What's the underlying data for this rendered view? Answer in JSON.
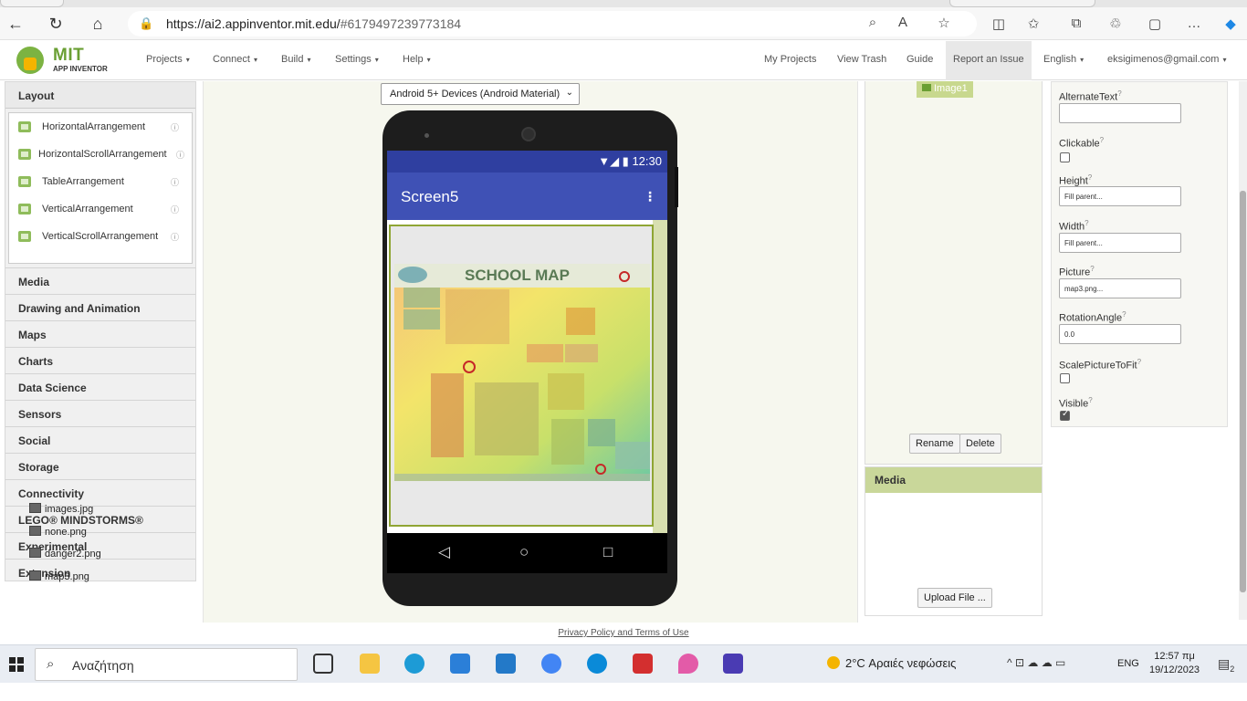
{
  "browser": {
    "url_main": "https://ai2.appinventor.mit.edu/",
    "url_rest": "#6179497239773184"
  },
  "header": {
    "logo_top": "MIT",
    "logo_bottom": "APP INVENTOR",
    "menus": [
      "Projects",
      "Connect",
      "Build",
      "Settings",
      "Help"
    ],
    "right_links": [
      "My Projects",
      "View Trash",
      "Guide",
      "Report an Issue",
      "English",
      "eksigimenos@gmail.com"
    ]
  },
  "palette": {
    "layout_title": "Layout",
    "layout_items": [
      "HorizontalArrangement",
      "HorizontalScrollArrangement",
      "TableArrangement",
      "VerticalArrangement",
      "VerticalScrollArrangement"
    ],
    "categories": [
      "Media",
      "Drawing and Animation",
      "Maps",
      "Charts",
      "Data Science",
      "Sensors",
      "Social",
      "Storage",
      "Connectivity",
      "LEGO® MINDSTORMS®",
      "Experimental",
      "Extension"
    ]
  },
  "viewer": {
    "device_select": "Android 5+ Devices (Android Material)",
    "status_time": "12:30",
    "screen_title": "Screen5",
    "map_title": "SCHOOL MAP"
  },
  "components": {
    "selected": "Image1",
    "rename_label": "Rename",
    "delete_label": "Delete"
  },
  "media": {
    "title": "Media",
    "files": [
      "images.jpg",
      "none.png",
      "danger2.png",
      "map3.png"
    ],
    "upload_label": "Upload File ..."
  },
  "properties": {
    "alternate_text": "AlternateText",
    "clickable": "Clickable",
    "height": "Height",
    "height_value": "Fill parent...",
    "width": "Width",
    "width_value": "Fill parent...",
    "picture": "Picture",
    "picture_value": "map3.png...",
    "rotation": "RotationAngle",
    "rotation_value": "0.0",
    "scale": "ScalePictureToFit",
    "visible": "Visible",
    "help_mark": "?"
  },
  "footer": {
    "link": "Privacy Policy and Terms of Use"
  },
  "taskbar": {
    "search_placeholder": "Αναζήτηση",
    "weather": "2°C Αραιές νεφώσεις",
    "lang": "ENG",
    "time": "12:57 πμ",
    "date": "19/12/2023",
    "notif_count": "2"
  }
}
